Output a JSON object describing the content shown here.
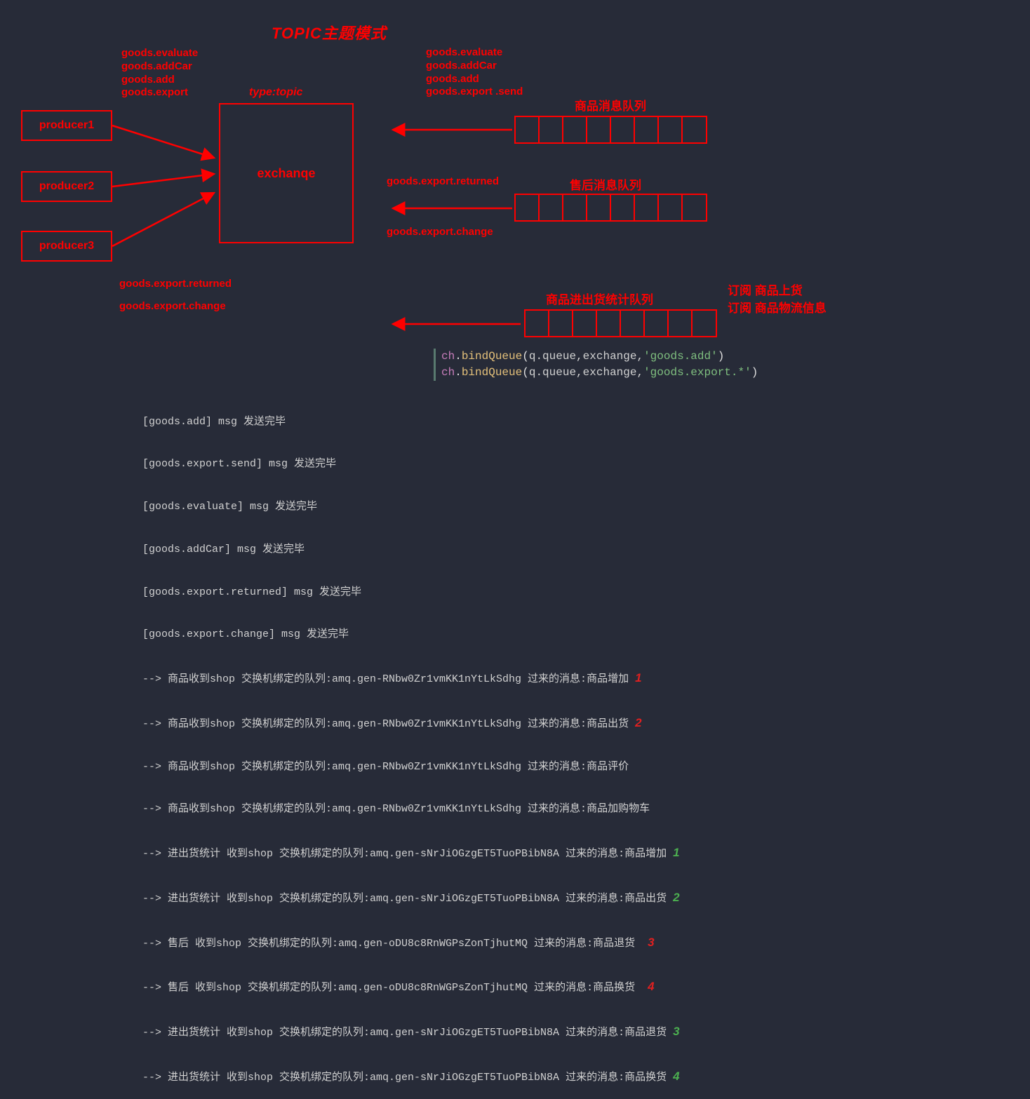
{
  "title": "TOPIC主题模式",
  "producers": {
    "p1": "producer1",
    "p2": "producer2",
    "p3": "producer3"
  },
  "exchange": {
    "type_label": "type:topic",
    "label": "exchanqe"
  },
  "producer_keys": {
    "top": "goods.evaluate\ngoods.addCar\ngoods.add\ngoods.export",
    "bottom1": "goods.export.returned",
    "bottom2": "goods.export.change"
  },
  "goods_queue": {
    "keys": "goods.evaluate\ngoods.addCar\ngoods.add\ngoods.export .send",
    "label": "商品消息队列"
  },
  "after_queue": {
    "key_top": "goods.export.returned",
    "key_bot": "goods.export.change",
    "label": "售后消息队列"
  },
  "stats_queue": {
    "label": "商品进出货统计队列",
    "sub1": "订阅 商品上货",
    "sub2": "订阅 商品物流信息"
  },
  "code": {
    "line1": {
      "prefix": "ch",
      "method": "bindQueue",
      "args_plain": "q.queue,exchange,",
      "str": "'goods.add'"
    },
    "line2": {
      "prefix": "ch",
      "method": "bindQueue",
      "args_plain": "q.queue,exchange,",
      "str": "'goods.export.*'"
    }
  },
  "log": {
    "l1": "[goods.add] msg 发送完毕",
    "l2": "[goods.export.send] msg 发送完毕",
    "l3": "[goods.evaluate] msg 发送完毕",
    "l4": "[goods.addCar] msg 发送完毕",
    "l5": "[goods.export.returned] msg 发送完毕",
    "l6": "[goods.export.change] msg 发送完毕",
    "l7": "--> 商品收到shop 交换机绑定的队列:amq.gen-RNbw0Zr1vmKK1nYtLkSdhg 过来的消息:商品增加",
    "l8": "--> 商品收到shop 交换机绑定的队列:amq.gen-RNbw0Zr1vmKK1nYtLkSdhg 过来的消息:商品出货",
    "l9": "--> 商品收到shop 交换机绑定的队列:amq.gen-RNbw0Zr1vmKK1nYtLkSdhg 过来的消息:商品评价",
    "l10": "--> 商品收到shop 交换机绑定的队列:amq.gen-RNbw0Zr1vmKK1nYtLkSdhg 过来的消息:商品加购物车",
    "l11": "--> 进出货统计 收到shop 交换机绑定的队列:amq.gen-sNrJiOGzgET5TuoPBibN8A 过来的消息:商品增加",
    "l12": "--> 进出货统计 收到shop 交换机绑定的队列:amq.gen-sNrJiOGzgET5TuoPBibN8A 过来的消息:商品出货",
    "l13": "--> 售后 收到shop 交换机绑定的队列:amq.gen-oDU8c8RnWGPsZonTjhutMQ 过来的消息:商品退货",
    "l14": "--> 售后 收到shop 交换机绑定的队列:amq.gen-oDU8c8RnWGPsZonTjhutMQ 过来的消息:商品换货",
    "l15": "--> 进出货统计 收到shop 交换机绑定的队列:amq.gen-sNrJiOGzgET5TuoPBibN8A 过来的消息:商品退货",
    "l16": "--> 进出货统计 收到shop 交换机绑定的队列:amq.gen-sNrJiOGzgET5TuoPBibN8A 过来的消息:商品换货"
  },
  "ann": {
    "r1": "1",
    "r2": "2",
    "g1": "1",
    "g2": "2",
    "r3": "3",
    "r4": "4",
    "g3": "3",
    "g4": "4"
  }
}
